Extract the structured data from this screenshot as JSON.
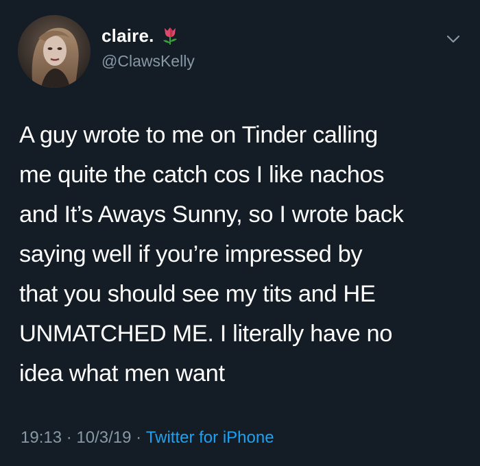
{
  "user": {
    "display_name": "claire.",
    "handle": "@ClawsKelly",
    "name_emoji": "tulip-icon"
  },
  "tweet": {
    "text": "A guy wrote to me on Tinder calling\nme quite the catch cos I like nachos\nand It’s Aways Sunny, so I wrote back\nsaying well if you’re impressed by\nthat you should see my tits and HE\nUNMATCHED ME. I literally have no\nidea what men want",
    "time": "19:13",
    "separator": " · ",
    "date": "10/3/19",
    "source": "Twitter for iPhone"
  },
  "colors": {
    "background": "#141d26",
    "secondary_text": "#8899a6",
    "accent": "#1da1f2"
  },
  "icons": {
    "menu": "chevron-down-icon"
  }
}
